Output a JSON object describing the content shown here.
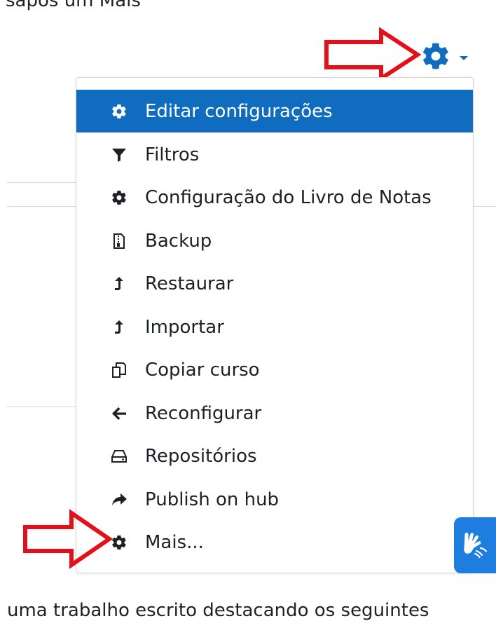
{
  "page": {
    "top_text": "sapos um Mais",
    "bottom_text": "uma trabalho escrito destacando os seguintes"
  },
  "colors": {
    "accent": "#0f6cbf",
    "annotation": "#e3101a",
    "accessibility": "#1d7ee0"
  },
  "settings_menu": {
    "toggle_icon": "gear-icon",
    "items": [
      {
        "label": "Editar configurações",
        "icon": "gear-icon",
        "active": true
      },
      {
        "label": "Filtros",
        "icon": "filter-icon"
      },
      {
        "label": "Configuração do Livro de Notas",
        "icon": "gear-icon"
      },
      {
        "label": "Backup",
        "icon": "file-archive-icon"
      },
      {
        "label": "Restaurar",
        "icon": "level-up-icon"
      },
      {
        "label": "Importar",
        "icon": "level-up-icon"
      },
      {
        "label": "Copiar curso",
        "icon": "copy-icon"
      },
      {
        "label": "Reconfigurar",
        "icon": "arrow-left-icon"
      },
      {
        "label": "Repositórios",
        "icon": "hard-drive-icon"
      },
      {
        "label": "Publish on hub",
        "icon": "share-icon"
      },
      {
        "label": "Mais...",
        "icon": "gear-icon"
      }
    ]
  },
  "accessibility_button": {
    "icon": "sign-language-icon"
  }
}
